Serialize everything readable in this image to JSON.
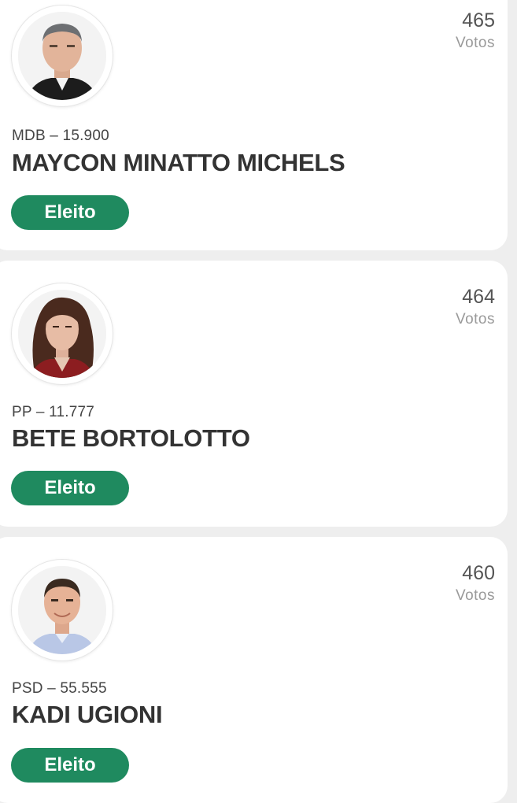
{
  "candidates": [
    {
      "votes": "465",
      "votes_label": "Votos",
      "party": "MDB – 15.900",
      "name": "MAYCON MINATTO MICHELS",
      "status": "Eleito",
      "photo_icon": "candidate-photo"
    },
    {
      "votes": "464",
      "votes_label": "Votos",
      "party": "PP – 11.777",
      "name": "BETE BORTOLOTTO",
      "status": "Eleito",
      "photo_icon": "candidate-photo"
    },
    {
      "votes": "460",
      "votes_label": "Votos",
      "party": "PSD – 55.555",
      "name": "KADI UGIONI",
      "status": "Eleito",
      "photo_icon": "candidate-photo"
    }
  ],
  "colors": {
    "status_bg": "#1f8a5f",
    "page_bg": "#eeeeee",
    "card_bg": "#ffffff"
  }
}
